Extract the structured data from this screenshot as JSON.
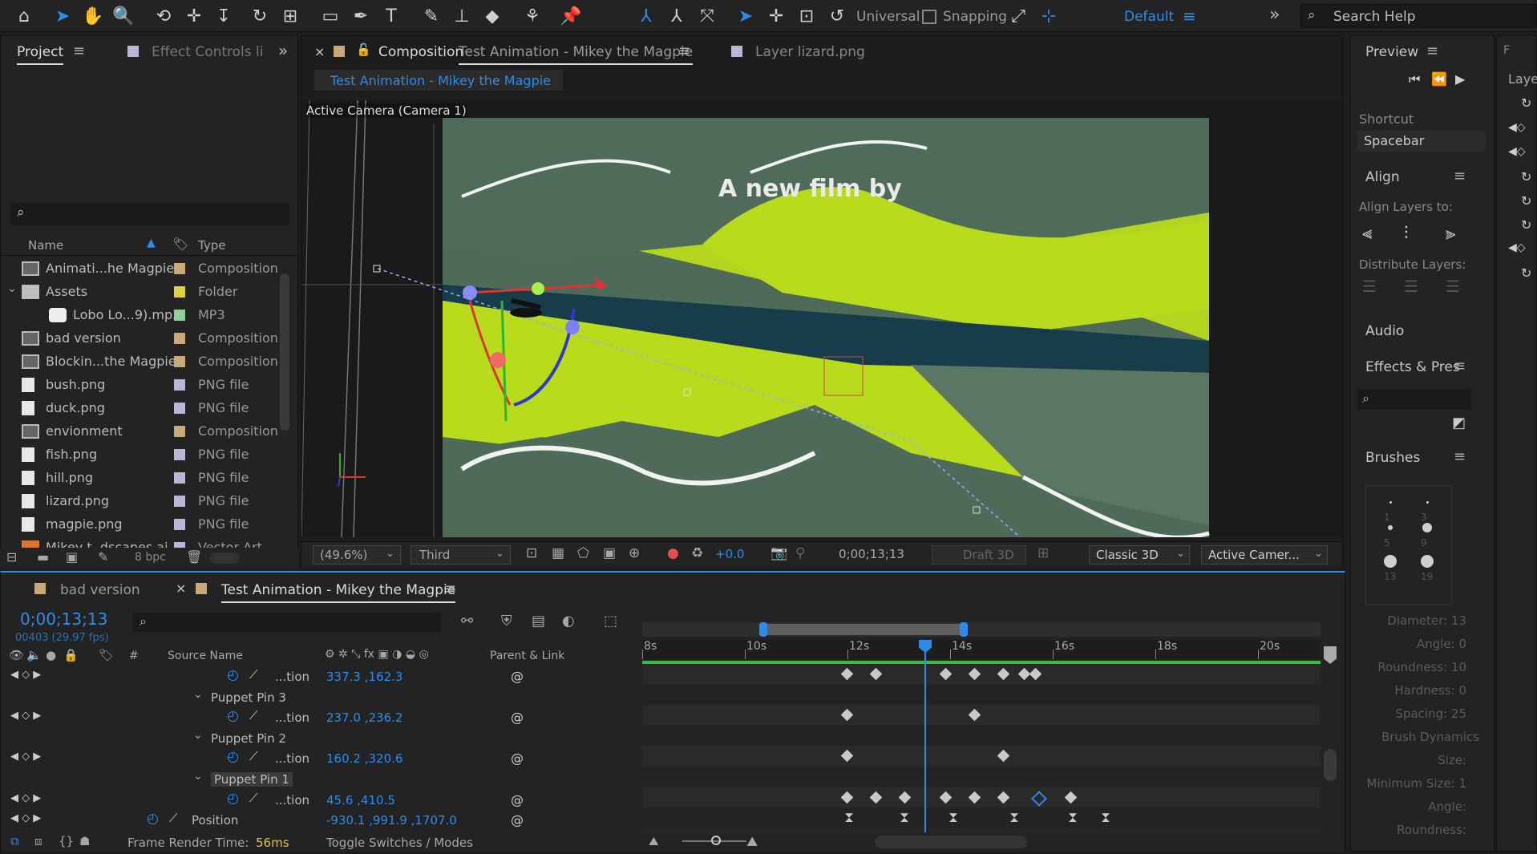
{
  "toolbar": {
    "workspace": "Default",
    "universal": "Universal",
    "snapping": "Snapping",
    "search_help": "Search Help"
  },
  "project": {
    "tab": "Project",
    "effect_tab": "Effect Controls li",
    "col_name": "Name",
    "col_type": "Type",
    "bpc": "8 bpc",
    "items": [
      {
        "name": "Animati...he Magpie",
        "type": "Composition",
        "color": "#c9a87a",
        "icon": "comp"
      },
      {
        "name": "Assets",
        "type": "Folder",
        "color": "#e0d23a",
        "icon": "folder"
      },
      {
        "name": "Lobo Lo...9).mp3",
        "type": "MP3",
        "color": "#8fcf9a",
        "icon": "audio"
      },
      {
        "name": "bad version",
        "type": "Composition",
        "color": "#c9a87a",
        "icon": "comp"
      },
      {
        "name": "Blockin...the Magpie",
        "type": "Composition",
        "color": "#c9a87a",
        "icon": "comp"
      },
      {
        "name": "bush.png",
        "type": "PNG file",
        "color": "#b7b7d6",
        "icon": "file"
      },
      {
        "name": "duck.png",
        "type": "PNG file",
        "color": "#b7b7d6",
        "icon": "file"
      },
      {
        "name": "envionment",
        "type": "Composition",
        "color": "#c9a87a",
        "icon": "comp"
      },
      {
        "name": "fish.png",
        "type": "PNG file",
        "color": "#b7b7d6",
        "icon": "file"
      },
      {
        "name": "hill.png",
        "type": "PNG file",
        "color": "#b7b7d6",
        "icon": "file"
      },
      {
        "name": "lizard.png",
        "type": "PNG file",
        "color": "#b7b7d6",
        "icon": "file"
      },
      {
        "name": "magpie.png",
        "type": "PNG file",
        "color": "#b7b7d6",
        "icon": "file"
      },
      {
        "name": "Mikey t..dscapes.ai",
        "type": "Vector Art",
        "color": "#b7b7d6",
        "icon": "ai"
      }
    ]
  },
  "composition": {
    "tab_prefix": "Composition",
    "tab_name": "Test Animation - Mikey the Magpie",
    "layer_tab": "Layer  lizard.png",
    "breadcrumb": "Test Animation - Mikey the Magpie",
    "camera_label": "Active Camera (Camera 1)",
    "film_text": "A new film by",
    "footer": {
      "zoom": "(49.6%)",
      "resolution": "Third",
      "exposure": "+0.0",
      "timecode": "0;00;13;13",
      "draft": "Draft 3D",
      "renderer": "Classic 3D",
      "view": "Active Camer..."
    }
  },
  "timeline": {
    "tab_bad": "bad version",
    "tab_active": "Test Animation - Mikey the Magpie",
    "timecode": "0;00;13;13",
    "frame_info": "00403 (29.97 fps)",
    "col_hash": "#",
    "col_source": "Source Name",
    "col_parent": "Parent & Link",
    "ruler": [
      "8s",
      "10s",
      "12s",
      "14s",
      "16s",
      "18s",
      "20s"
    ],
    "rows": [
      {
        "label": "...tion",
        "value": "337.3 ,162.3",
        "kind": "prop"
      },
      {
        "label": "Puppet Pin 3",
        "value": "",
        "kind": "pin"
      },
      {
        "label": "...tion",
        "value": "237.0 ,236.2",
        "kind": "prop"
      },
      {
        "label": "Puppet Pin 2",
        "value": "",
        "kind": "pin"
      },
      {
        "label": "...tion",
        "value": "160.2 ,320.6",
        "kind": "prop"
      },
      {
        "label": "Puppet Pin 1",
        "value": "",
        "kind": "pin"
      },
      {
        "label": "...tion",
        "value": "45.6 ,410.5",
        "kind": "prop"
      },
      {
        "label": "Position",
        "value": "-930.1 ,991.9 ,1707.0",
        "kind": "prop"
      }
    ],
    "frame_render_label": "Frame Render Time:",
    "frame_render_value": "56ms",
    "toggle_label": "Toggle Switches / Modes"
  },
  "right": {
    "preview": "Preview",
    "shortcut_label": "Shortcut",
    "shortcut_value": "Spacebar",
    "align": "Align",
    "align_to": "Align Layers to:",
    "distribute": "Distribute Layers:",
    "audio": "Audio",
    "effects": "Effects & Pres",
    "brushes": "Brushes",
    "brush_sizes": [
      "1",
      "3",
      "5",
      "9",
      "13",
      "19"
    ],
    "brush_props": [
      "Diameter: 13",
      "Angle: 0",
      "Roundness: 10",
      "Hardness: 0",
      "Spacing: 25",
      "Brush Dynamics",
      "Size:",
      "Minimum Size: 1",
      "Angle:",
      "Roundness:"
    ],
    "layer_tab": "Laye"
  }
}
